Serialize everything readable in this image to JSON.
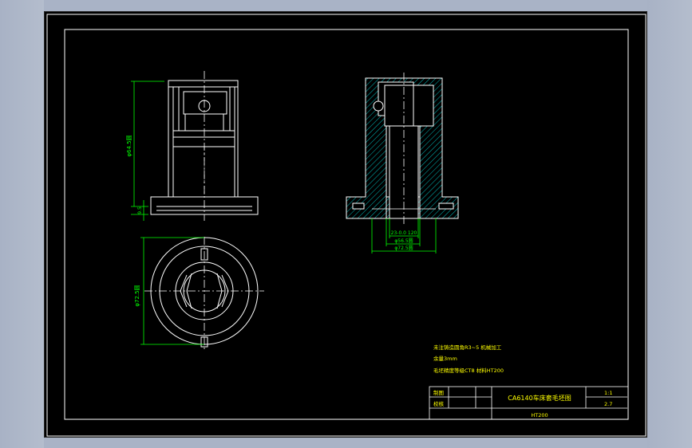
{
  "drawing": {
    "title": "CA6140车床套毛坯图",
    "material": "HT200",
    "scale": "1:1",
    "sheet_value": "2.7",
    "signoff": {
      "drawn_label": "制图",
      "checked_label": "校核"
    },
    "notes": [
      "未注铸造圆角R3~5 机械加工",
      "余量3mm",
      "毛坯精度等级CT8 材料HT200"
    ],
    "dimensions": {
      "front_height": "φ64.5圆",
      "flange_thickness": "9.5",
      "top_circle_diameter": "φ72.5圆",
      "section_bore": "23-0.0 120",
      "section_inner": "φ56.5圆",
      "section_outer": "φ72.5圆"
    }
  },
  "colors": {
    "line": "#ffffff",
    "dimension": "#00ff00",
    "hatch": "#00c0c0",
    "note": "#ffff00",
    "title_text": "#ffff00",
    "center": "#ffffff"
  }
}
